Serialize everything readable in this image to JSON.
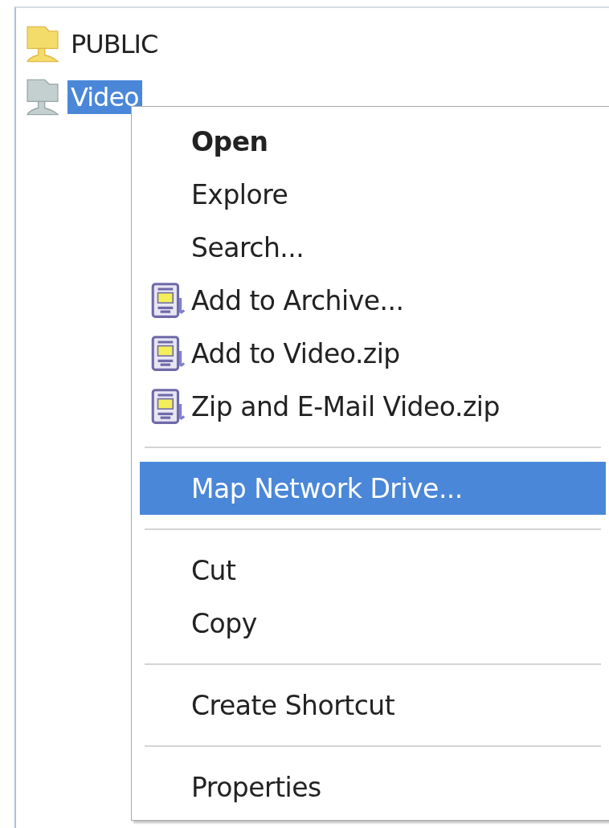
{
  "tree": {
    "items": [
      {
        "label": "PUBLIC",
        "selected": false
      },
      {
        "label": "Video",
        "selected": true
      }
    ]
  },
  "context_menu": {
    "items": [
      {
        "kind": "item",
        "label": "Open",
        "default": true,
        "selected": false
      },
      {
        "kind": "item",
        "label": "Explore",
        "default": false,
        "selected": false
      },
      {
        "kind": "item",
        "label": "Search...",
        "default": false,
        "selected": false
      },
      {
        "kind": "archive_item",
        "label": "Add to Archive...",
        "default": false,
        "selected": false
      },
      {
        "kind": "archive_item",
        "label": "Add to Video.zip",
        "default": false,
        "selected": false
      },
      {
        "kind": "archive_item",
        "label": "Zip and E-Mail Video.zip",
        "default": false,
        "selected": false
      },
      {
        "kind": "separator"
      },
      {
        "kind": "item",
        "label": "Map Network Drive...",
        "default": false,
        "selected": true
      },
      {
        "kind": "separator"
      },
      {
        "kind": "item",
        "label": "Cut",
        "default": false,
        "selected": false
      },
      {
        "kind": "item",
        "label": "Copy",
        "default": false,
        "selected": false
      },
      {
        "kind": "separator"
      },
      {
        "kind": "item",
        "label": "Create Shortcut",
        "default": false,
        "selected": false
      },
      {
        "kind": "separator"
      },
      {
        "kind": "item",
        "label": "Properties",
        "default": false,
        "selected": false
      }
    ]
  }
}
